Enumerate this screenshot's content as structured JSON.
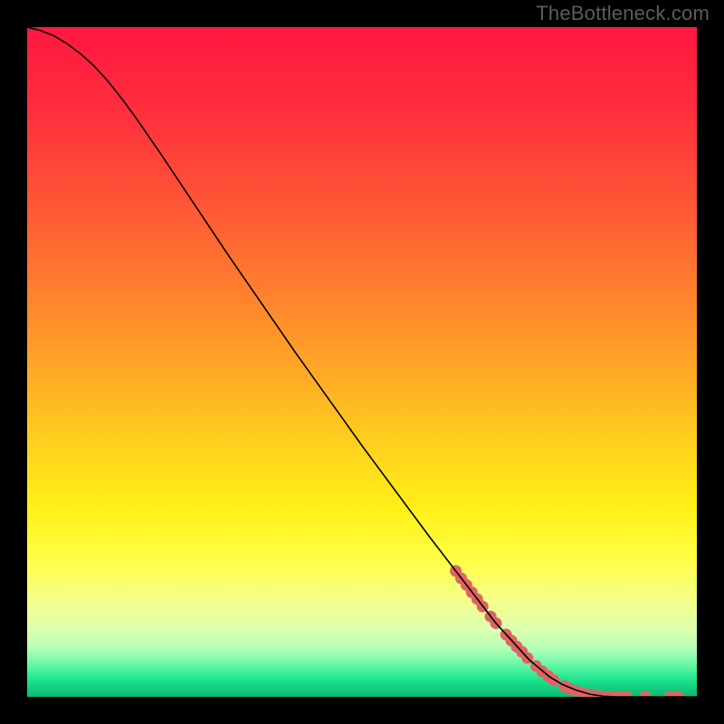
{
  "watermark": "TheBottleneck.com",
  "chart_data": {
    "type": "line",
    "title": "",
    "xlabel": "",
    "ylabel": "",
    "xlim": [
      0,
      100
    ],
    "ylim": [
      0,
      100
    ],
    "grid": false,
    "legend": false,
    "background": {
      "type": "vertical-gradient",
      "stops": [
        {
          "pos": 0.0,
          "color": "#ff173f"
        },
        {
          "pos": 0.12,
          "color": "#ff2d3d"
        },
        {
          "pos": 0.25,
          "color": "#ff5236"
        },
        {
          "pos": 0.38,
          "color": "#ff7a2f"
        },
        {
          "pos": 0.5,
          "color": "#ffa327"
        },
        {
          "pos": 0.62,
          "color": "#ffcf1e"
        },
        {
          "pos": 0.72,
          "color": "#fff016"
        },
        {
          "pos": 0.8,
          "color": "#ffff4a"
        },
        {
          "pos": 0.86,
          "color": "#f3ff8e"
        },
        {
          "pos": 0.9,
          "color": "#dcffb0"
        },
        {
          "pos": 0.93,
          "color": "#afffb6"
        },
        {
          "pos": 0.955,
          "color": "#5bf7a3"
        },
        {
          "pos": 0.975,
          "color": "#1be28e"
        },
        {
          "pos": 1.0,
          "color": "#0cb870"
        }
      ]
    },
    "series": [
      {
        "name": "curve",
        "stroke": "#000000",
        "stroke_width": 1.6,
        "x": [
          0,
          2,
          4,
          6,
          8,
          10,
          12,
          14,
          16,
          20,
          30,
          40,
          50,
          60,
          70,
          75,
          78,
          80,
          82,
          84,
          86,
          88,
          100
        ],
        "y": [
          100,
          99.5,
          98.7,
          97.5,
          96.0,
          94.2,
          92.0,
          89.5,
          86.8,
          81.0,
          66.0,
          51.5,
          37.5,
          24.0,
          11.0,
          5.5,
          3.0,
          1.8,
          1.0,
          0.4,
          0.1,
          0.0,
          0.0
        ]
      }
    ],
    "markers": {
      "name": "highlight-dots",
      "color": "#e06363",
      "radius": 6.5,
      "points": [
        {
          "x": 64.0,
          "y": 18.8
        },
        {
          "x": 64.8,
          "y": 17.7
        },
        {
          "x": 65.6,
          "y": 16.7
        },
        {
          "x": 66.4,
          "y": 15.6
        },
        {
          "x": 67.2,
          "y": 14.6
        },
        {
          "x": 68.0,
          "y": 13.5
        },
        {
          "x": 69.2,
          "y": 12.0
        },
        {
          "x": 70.0,
          "y": 11.0
        },
        {
          "x": 71.5,
          "y": 9.3
        },
        {
          "x": 72.3,
          "y": 8.4
        },
        {
          "x": 73.1,
          "y": 7.5
        },
        {
          "x": 73.9,
          "y": 6.7
        },
        {
          "x": 74.7,
          "y": 5.8
        },
        {
          "x": 76.0,
          "y": 4.6
        },
        {
          "x": 76.9,
          "y": 3.8
        },
        {
          "x": 77.8,
          "y": 3.1
        },
        {
          "x": 78.6,
          "y": 2.5
        },
        {
          "x": 80.2,
          "y": 1.6
        },
        {
          "x": 81.0,
          "y": 1.2
        },
        {
          "x": 81.9,
          "y": 0.9
        },
        {
          "x": 83.1,
          "y": 0.5
        },
        {
          "x": 84.2,
          "y": 0.3
        },
        {
          "x": 85.4,
          "y": 0.1
        },
        {
          "x": 86.4,
          "y": 0.0
        },
        {
          "x": 87.4,
          "y": 0.0
        },
        {
          "x": 88.4,
          "y": 0.0
        },
        {
          "x": 89.5,
          "y": 0.0
        },
        {
          "x": 92.3,
          "y": 0.0
        },
        {
          "x": 96.0,
          "y": 0.0
        },
        {
          "x": 97.2,
          "y": 0.0
        }
      ]
    }
  }
}
